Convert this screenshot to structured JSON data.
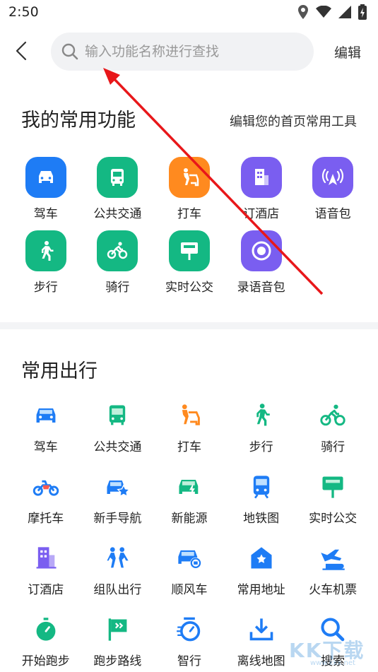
{
  "status": {
    "time": "2:50"
  },
  "search": {
    "placeholder": "输入功能名称进行查找"
  },
  "header": {
    "edit_label": "编辑"
  },
  "my_functions": {
    "title": "我的常用功能",
    "subtitle": "编辑您的首页常用工具",
    "items": [
      {
        "label": "驾车",
        "icon": "car-icon",
        "color": "#1e7cf5"
      },
      {
        "label": "公共交通",
        "icon": "bus-icon",
        "color": "#14b883"
      },
      {
        "label": "打车",
        "icon": "taxi-icon",
        "color": "#ff8a1f"
      },
      {
        "label": "订酒店",
        "icon": "hotel-icon",
        "color": "#7a5ef0"
      },
      {
        "label": "语音包",
        "icon": "voice-pack-icon",
        "color": "#7a5ef0"
      },
      {
        "label": "步行",
        "icon": "walk-icon",
        "color": "#14b883"
      },
      {
        "label": "骑行",
        "icon": "bike-icon",
        "color": "#14b883"
      },
      {
        "label": "实时公交",
        "icon": "realtime-bus-icon",
        "color": "#14b883"
      },
      {
        "label": "录语音包",
        "icon": "record-icon",
        "color": "#7a5ef0"
      }
    ]
  },
  "common_travel": {
    "title": "常用出行",
    "items": [
      {
        "label": "驾车",
        "icon": "car-icon",
        "color": "#1e7cf5"
      },
      {
        "label": "公共交通",
        "icon": "bus-icon",
        "color": "#14b883"
      },
      {
        "label": "打车",
        "icon": "taxi-icon",
        "color": "#ff8a1f"
      },
      {
        "label": "步行",
        "icon": "walk-icon",
        "color": "#14b883"
      },
      {
        "label": "骑行",
        "icon": "bike-icon",
        "color": "#14b883"
      },
      {
        "label": "摩托车",
        "icon": "motorcycle-icon",
        "color": "#1e7cf5"
      },
      {
        "label": "新手导航",
        "icon": "novice-nav-icon",
        "color": "#1e7cf5"
      },
      {
        "label": "新能源",
        "icon": "new-energy-icon",
        "color": "#14b883"
      },
      {
        "label": "地铁图",
        "icon": "subway-icon",
        "color": "#1e7cf5"
      },
      {
        "label": "实时公交",
        "icon": "realtime-bus-icon",
        "color": "#14b883"
      },
      {
        "label": "订酒店",
        "icon": "hotel-icon",
        "color": "#7a5ef0"
      },
      {
        "label": "组队出行",
        "icon": "team-icon",
        "color": "#1e7cf5"
      },
      {
        "label": "顺风车",
        "icon": "carpool-icon",
        "color": "#1e7cf5"
      },
      {
        "label": "常用地址",
        "icon": "favorite-address-icon",
        "color": "#1e7cf5"
      },
      {
        "label": "火车机票",
        "icon": "train-plane-icon",
        "color": "#1e7cf5"
      },
      {
        "label": "开始跑步",
        "icon": "stopwatch-icon",
        "color": "#14b883"
      },
      {
        "label": "跑步路线",
        "icon": "running-route-icon",
        "color": "#14b883"
      },
      {
        "label": "智行",
        "icon": "smart-travel-icon",
        "color": "#1e7cf5"
      },
      {
        "label": "离线地图",
        "icon": "download-icon",
        "color": "#1e7cf5"
      },
      {
        "label": "搜索",
        "icon": "search-icon",
        "color": "#1e7cf5"
      }
    ]
  },
  "watermark": {
    "text": "KK下载",
    "url": "www.kkx.net"
  }
}
